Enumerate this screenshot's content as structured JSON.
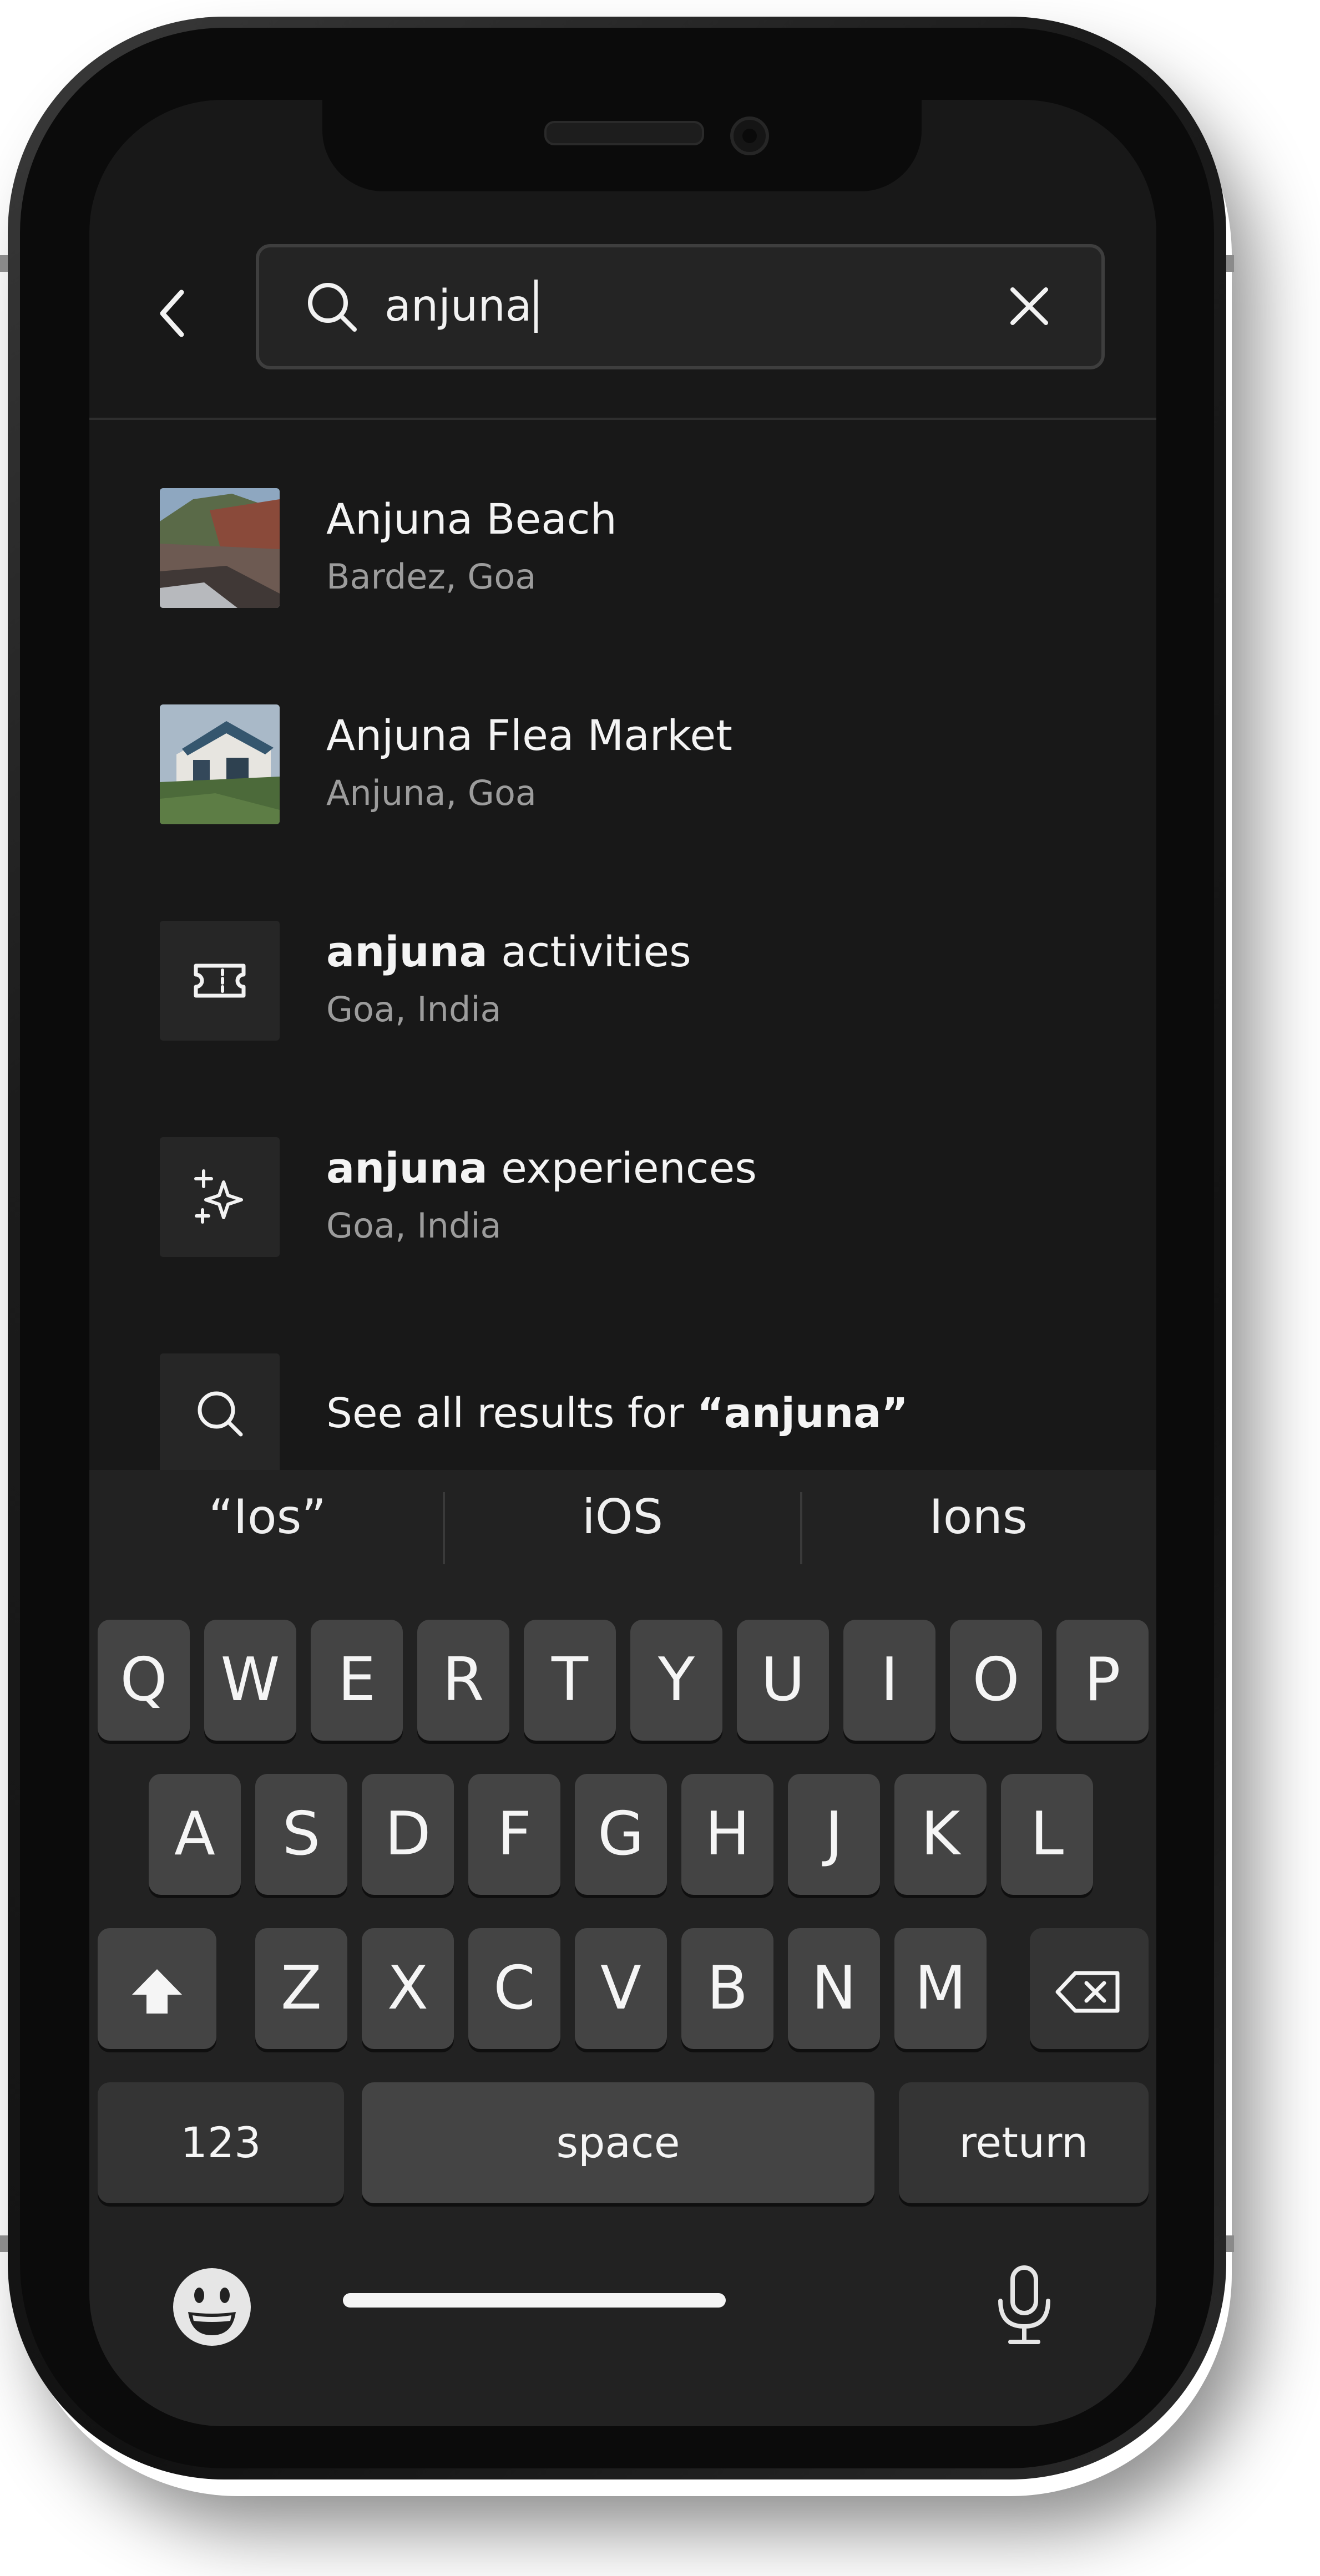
{
  "search": {
    "query": "anjuna"
  },
  "results": [
    {
      "title": "Anjuna Beach",
      "subtitle": "Bardez, Goa"
    },
    {
      "title": "Anjuna Flea Market",
      "subtitle": "Anjuna, Goa"
    },
    {
      "title_bold": "anjuna",
      "title_rest": " activities",
      "subtitle": "Goa, India",
      "icon": "ticket-icon"
    },
    {
      "title_bold": "anjuna",
      "title_rest": " experiences",
      "subtitle": "Goa, India",
      "icon": "sparkles-icon"
    }
  ],
  "see_all": {
    "prefix": "See all results for ",
    "query": "“anjuna”",
    "icon": "search-icon"
  },
  "keyboard": {
    "suggestions": [
      "“Ios”",
      "iOS",
      "Ions"
    ],
    "row1": [
      "Q",
      "W",
      "E",
      "R",
      "T",
      "Y",
      "U",
      "I",
      "O",
      "P"
    ],
    "row2": [
      "A",
      "S",
      "D",
      "F",
      "G",
      "H",
      "J",
      "K",
      "L"
    ],
    "row3": [
      "Z",
      "X",
      "C",
      "V",
      "B",
      "N",
      "M"
    ],
    "numbers_label": "123",
    "space_label": "space",
    "return_label": "return"
  },
  "colors": {
    "screen_bg": "#181818",
    "keyboard_bg": "#222222",
    "key_bg": "#444444",
    "text_primary": "#f4f4f4",
    "text_secondary": "#9c9c9c"
  }
}
